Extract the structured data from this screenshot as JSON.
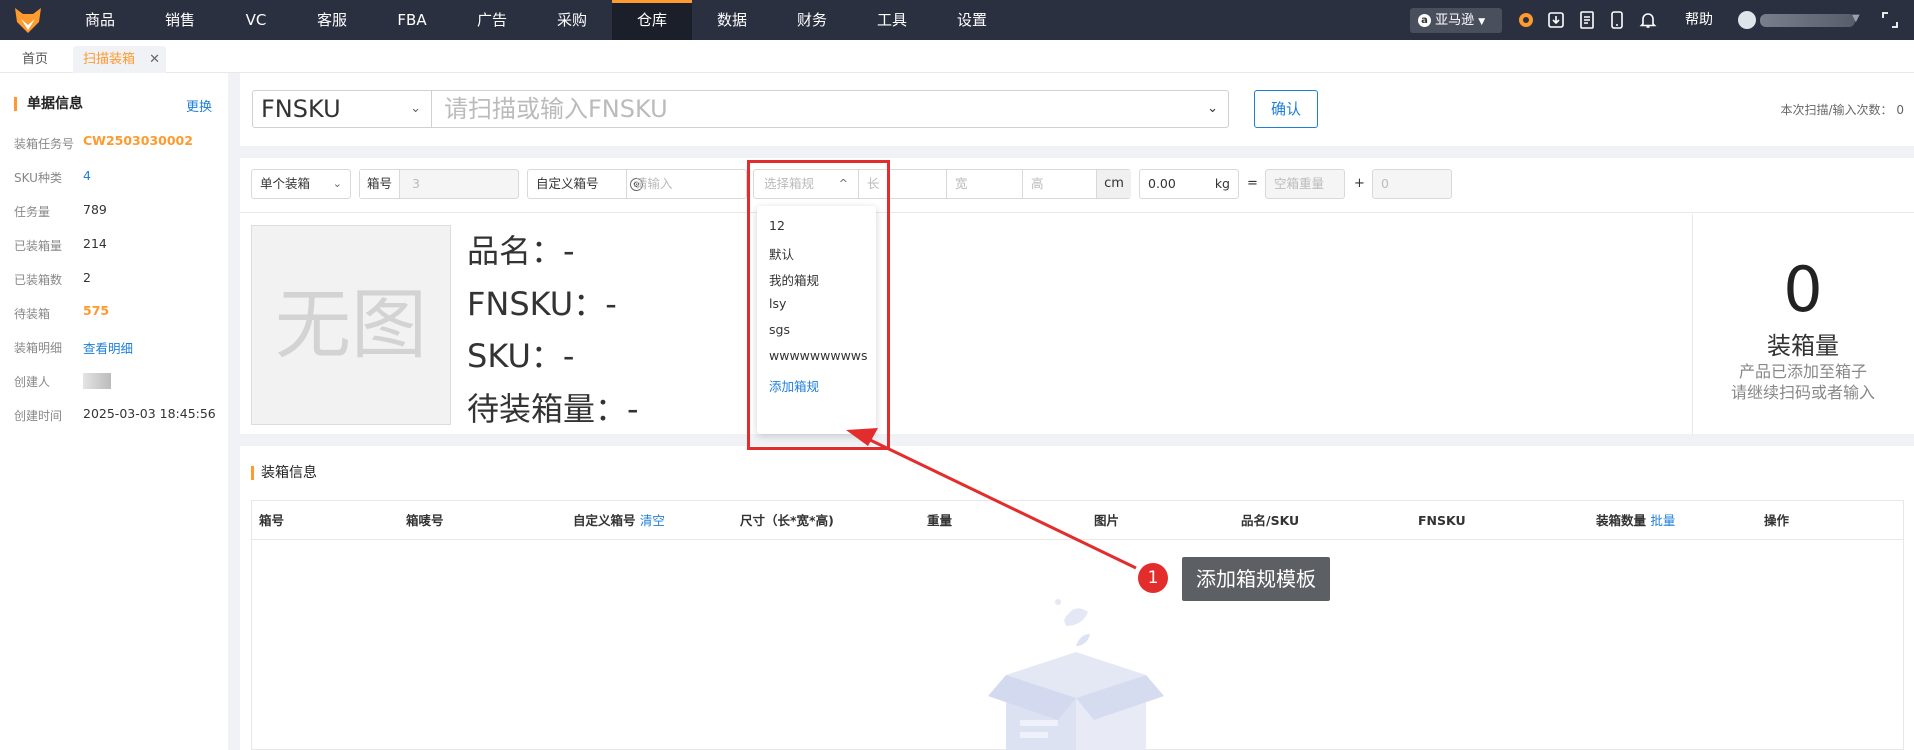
{
  "nav": {
    "items": [
      "商品",
      "销售",
      "VC",
      "客服",
      "FBA",
      "广告",
      "采购",
      "仓库",
      "数据",
      "财务",
      "工具",
      "设置"
    ],
    "active_index": 7,
    "amazon_label": "亚马逊",
    "help": "帮助"
  },
  "tabs": {
    "home": "首页",
    "current": "扫描装箱",
    "close": "✕"
  },
  "left_panel": {
    "title": "单据信息",
    "change": "更换",
    "fields": [
      {
        "label": "装箱任务号",
        "value": "CW2503030002"
      },
      {
        "label": "SKU种类",
        "value": "4"
      },
      {
        "label": "任务量",
        "value": "789"
      },
      {
        "label": "已装箱量",
        "value": "214"
      },
      {
        "label": "已装箱数",
        "value": "2"
      },
      {
        "label": "待装箱",
        "value": "575"
      },
      {
        "label": "装箱明细",
        "value": "查看明细"
      },
      {
        "label": "创建人",
        "value": ""
      },
      {
        "label": "创建时间",
        "value": "2025-03-03 18:45:56"
      }
    ]
  },
  "scan": {
    "type": "FNSKU",
    "placeholder": "请扫描或输入FNSKU",
    "confirm": "确认",
    "count_text": "本次扫描/输入次数：",
    "count": "0"
  },
  "box_row": {
    "mode": "单个装箱",
    "box_no_label": "箱号",
    "box_no_value": "3",
    "custom_label": "自定义箱号",
    "custom_placeholder": "请输入",
    "spec_placeholder": "选择箱规",
    "len": "长",
    "wid": "宽",
    "hei": "高",
    "unit_cm": "cm",
    "weight": "0.00",
    "unit_kg": "kg",
    "eq": "=",
    "empty_weight": "空箱重量",
    "plus": "+",
    "extra": "0"
  },
  "dropdown": {
    "options": [
      "12",
      "默认",
      "我的箱规",
      "lsy",
      "sgs",
      "wwwwwwwwws"
    ],
    "add": "添加箱规"
  },
  "product": {
    "noimg": "无图",
    "name_line": "品名：-",
    "fnsku_line": "FNSKU：-",
    "sku_line": "SKU：-",
    "pending_line": "待装箱量：-",
    "count": "0",
    "count_label": "装箱量",
    "hint1": "产品已添加至箱子",
    "hint2": "请继续扫码或者输入"
  },
  "box_info": {
    "title": "装箱信息",
    "columns": [
      "箱号",
      "箱唛号",
      "自定义箱号",
      "尺寸（长*宽*高)",
      "重量",
      "图片",
      "品名/SKU",
      "FNSKU",
      "装箱数量",
      "操作"
    ],
    "clear": "清空",
    "batch": "批量"
  },
  "annotation": {
    "num": "1",
    "text": "添加箱规模板",
    "color": "#e32d2d"
  }
}
